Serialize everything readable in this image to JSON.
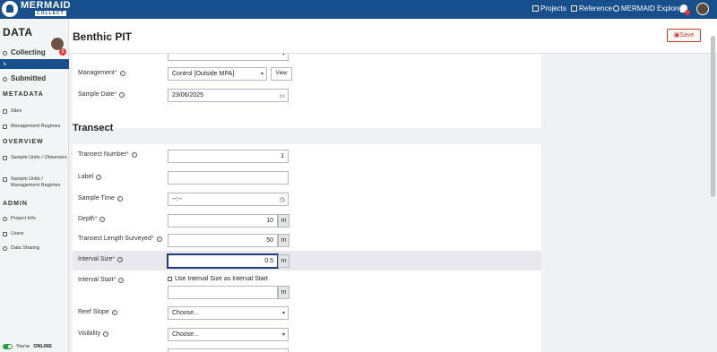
{
  "topbar": {
    "brand": "MERMAID",
    "brand_sub": "COLLECT",
    "links": [
      "Projects",
      "Reference",
      "MERMAID Explore"
    ]
  },
  "sidebar": {
    "title": "DATA",
    "badge_count": "2",
    "collecting": "Collecting",
    "submitted": "Submitted",
    "metadata_heading": "METADATA",
    "metadata_items": [
      "Sites",
      "Management Regimes"
    ],
    "overview_heading": "OVERVIEW",
    "overview_items": [
      "Sample Units / Observers",
      "Sample Units / Management Regimes"
    ],
    "admin_heading": "ADMIN",
    "admin_items": [
      "Project Info",
      "Users",
      "Data Sharing"
    ],
    "online_prefix": "You're",
    "online_status": "ONLINE"
  },
  "header": {
    "title": "Benthic PIT",
    "save_label": "Save"
  },
  "site_section": {
    "management_label": "Management*",
    "management_value": "Control [Outside MPA]",
    "view_label": "View",
    "sample_date_label": "Sample Date*",
    "sample_date_value": "23/06/2025"
  },
  "transect": {
    "heading": "Transect",
    "transect_number_label": "Transect Number*",
    "transect_number_value": "1",
    "label_label": "Label",
    "label_value": "",
    "sample_time_label": "Sample Time",
    "sample_time_value": "--:--",
    "depth_label": "Depth*",
    "depth_value": "10",
    "length_label": "Transect Length Surveyed*",
    "length_value": "50",
    "interval_size_label": "Interval Size*",
    "interval_size_value": "0.5",
    "interval_start_label": "Interval Start*",
    "interval_start_checkbox": "Use Interval Size as Interval Start",
    "interval_start_value": "",
    "reef_slope_label": "Reef Slope",
    "reef_slope_value": "Choose...",
    "visibility_label": "Visibility",
    "visibility_value": "Choose...",
    "unit_m": "m"
  },
  "colors": {
    "primary": "#174e8c",
    "accent": "#c7381d",
    "online": "#2e9d45"
  }
}
